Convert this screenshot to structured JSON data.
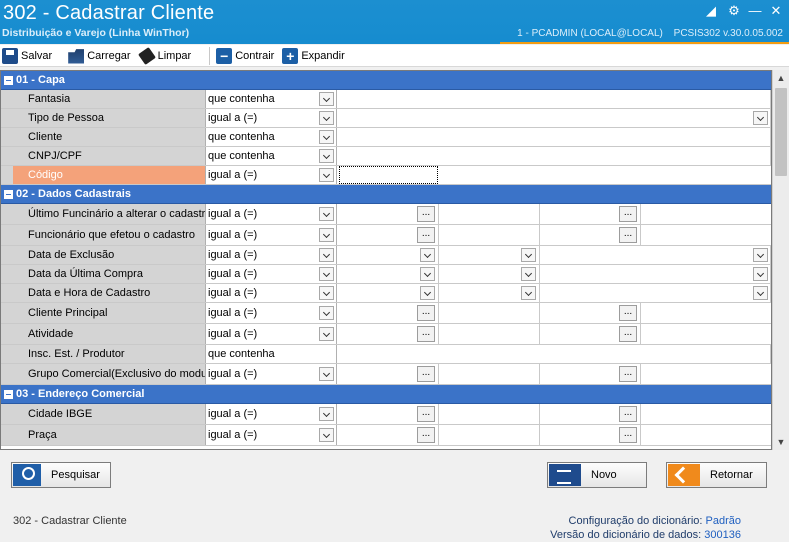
{
  "window": {
    "title": "302 - Cadastrar Cliente",
    "subtitle": "Distribuição e Varejo (Linha WinThor)",
    "user": "1 - PCADMIN (LOCAL@LOCAL)",
    "version": "PCSIS302  v.30.0.05.002"
  },
  "toolbar": {
    "save": "Salvar",
    "load": "Carregar",
    "clear": "Limpar",
    "collapse": "Contrair",
    "expand": "Expandir"
  },
  "sections": {
    "capa": {
      "title": "01 - Capa",
      "rows": [
        {
          "label": "Fantasia",
          "op": "que contenha"
        },
        {
          "label": "Tipo de Pessoa",
          "op": "igual a (=)"
        },
        {
          "label": "Cliente",
          "op": "que contenha"
        },
        {
          "label": "CNPJ/CPF",
          "op": "que contenha"
        },
        {
          "label": "Código",
          "op": "igual a (=)"
        }
      ]
    },
    "dados": {
      "title": "02 - Dados Cadastrais",
      "rows": [
        {
          "label": "Último Funcinário a alterar o cadastro",
          "op": "igual a (=)"
        },
        {
          "label": "Funcionário que efetou o cadastro",
          "op": "igual a (=)"
        },
        {
          "label": "Data de Exclusão",
          "op": "igual a (=)"
        },
        {
          "label": "Data da Última Compra",
          "op": "igual a (=)"
        },
        {
          "label": "Data e Hora de Cadastro",
          "op": "igual a (=)"
        },
        {
          "label": "Cliente Principal",
          "op": "igual a (=)"
        },
        {
          "label": "Atividade",
          "op": "igual a (=)"
        },
        {
          "label": "Insc. Est. / Produtor",
          "op": "que contenha"
        },
        {
          "label": "Grupo Comercial(Exclusivo do modulo)",
          "op": "igual a (=)"
        }
      ]
    },
    "endereco": {
      "title": "03 - Endereço Comercial",
      "rows": [
        {
          "label": "Cidade IBGE",
          "op": "igual a (=)"
        },
        {
          "label": "Praça",
          "op": "igual a (=)"
        }
      ]
    }
  },
  "buttons": {
    "search": "Pesquisar",
    "new": "Novo",
    "back": "Retornar"
  },
  "status": {
    "left": "302 - Cadastrar Cliente",
    "dict_label": "Configuração do dicionário:",
    "dict_value": "Padrão",
    "dict_version_label": "Versão do dicionário de dados:",
    "dict_version_value": "300136"
  },
  "colors": {
    "titlebar": "#168ccf",
    "section": "#3b73c8",
    "selected_label": "#f4a27a",
    "accent": "#f39c12"
  }
}
